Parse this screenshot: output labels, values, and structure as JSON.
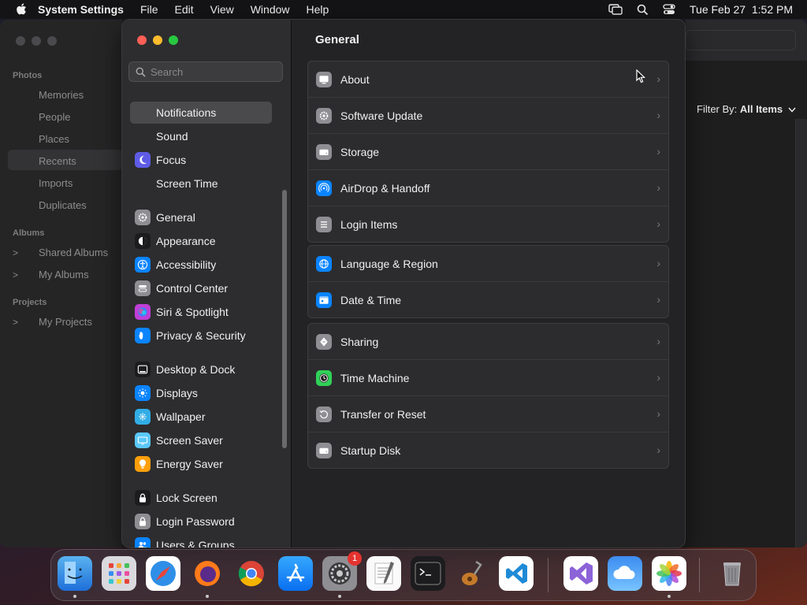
{
  "menubar": {
    "app_name": "System Settings",
    "menus": [
      "File",
      "Edit",
      "View",
      "Window",
      "Help"
    ],
    "clock": "Tue Feb 27  1:52 PM",
    "status_icons": [
      "screen-mirroring-icon",
      "search-icon",
      "control-center-icon"
    ]
  },
  "photos": {
    "sections": {
      "photos": "Photos",
      "albums": "Albums",
      "projects": "Projects"
    },
    "items": {
      "memories": "Memories",
      "people": "People",
      "places": "Places",
      "recents": "Recents",
      "imports": "Imports",
      "duplicates": "Duplicates",
      "shared_albums": "Shared Albums",
      "my_albums": "My Albums",
      "my_projects": "My Projects"
    },
    "filter_label": "Filter By:",
    "filter_value": "All Items"
  },
  "settings": {
    "search_placeholder": "Search",
    "sidebar": [
      {
        "label": "Notifications",
        "icon": "bell-icon",
        "color": "#e5463b"
      },
      {
        "label": "Sound",
        "icon": "speaker-icon",
        "color": "#e5463b"
      },
      {
        "label": "Focus",
        "icon": "moon-icon",
        "color": "#5e5ce6"
      },
      {
        "label": "Screen Time",
        "icon": "hourglass-icon",
        "color": "#5e5ce6"
      },
      {
        "label": "General",
        "icon": "gear-icon",
        "color": "#8e8e93"
      },
      {
        "label": "Appearance",
        "icon": "appearance-icon",
        "color": "#1c1c1e"
      },
      {
        "label": "Accessibility",
        "icon": "accessibility-icon",
        "color": "#0a84ff"
      },
      {
        "label": "Control Center",
        "icon": "control-center-icon",
        "color": "#8e8e93"
      },
      {
        "label": "Siri & Spotlight",
        "icon": "siri-icon",
        "color": "#c03fd6"
      },
      {
        "label": "Privacy & Security",
        "icon": "hand-icon",
        "color": "#0a84ff"
      },
      {
        "label": "Desktop & Dock",
        "icon": "dock-icon",
        "color": "#1c1c1e"
      },
      {
        "label": "Displays",
        "icon": "sun-icon",
        "color": "#0a84ff"
      },
      {
        "label": "Wallpaper",
        "icon": "wallpaper-icon",
        "color": "#32ade6"
      },
      {
        "label": "Screen Saver",
        "icon": "screen-saver-icon",
        "color": "#5ac8fa"
      },
      {
        "label": "Energy Saver",
        "icon": "lightbulb-icon",
        "color": "#ff9f0a"
      },
      {
        "label": "Lock Screen",
        "icon": "lock-icon",
        "color": "#1c1c1e"
      },
      {
        "label": "Login Password",
        "icon": "lock-icon",
        "color": "#8e8e93"
      },
      {
        "label": "Users & Groups",
        "icon": "users-icon",
        "color": "#0a84ff"
      }
    ],
    "content": {
      "title": "General",
      "groups": [
        [
          {
            "label": "About",
            "icon": "display-icon",
            "color": "#8e8e93"
          },
          {
            "label": "Software Update",
            "icon": "gear-icon",
            "color": "#8e8e93"
          },
          {
            "label": "Storage",
            "icon": "drive-icon",
            "color": "#8e8e93"
          },
          {
            "label": "AirDrop & Handoff",
            "icon": "airdrop-icon",
            "color": "#0a84ff"
          },
          {
            "label": "Login Items",
            "icon": "list-icon",
            "color": "#8e8e93"
          }
        ],
        [
          {
            "label": "Language & Region",
            "icon": "globe-icon",
            "color": "#0a84ff"
          },
          {
            "label": "Date & Time",
            "icon": "calendar-icon",
            "color": "#0a84ff"
          }
        ],
        [
          {
            "label": "Sharing",
            "icon": "sharing-icon",
            "color": "#8e8e93"
          },
          {
            "label": "Time Machine",
            "icon": "clock-icon",
            "color": "#30d158"
          },
          {
            "label": "Transfer or Reset",
            "icon": "reset-icon",
            "color": "#8e8e93"
          },
          {
            "label": "Startup Disk",
            "icon": "drive-icon",
            "color": "#8e8e93"
          }
        ]
      ]
    }
  },
  "dock": {
    "apps": [
      "Finder",
      "Launchpad",
      "Safari",
      "Firefox",
      "Chrome",
      "App Store",
      "System Settings",
      "TextEdit",
      "Terminal",
      "GarageBand",
      "Visual Studio Code",
      "Visual Studio",
      "iCloud",
      "Photos",
      "Trash"
    ],
    "badge": "1"
  }
}
